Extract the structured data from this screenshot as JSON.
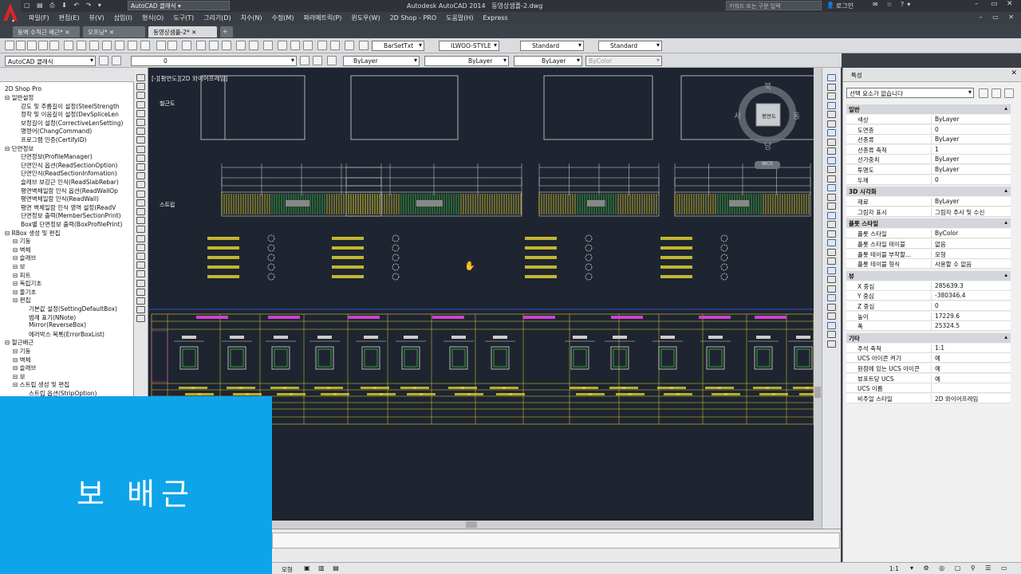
{
  "titlebar": {
    "quick_access": "AutoCAD 클래식",
    "title": "Autodesk AutoCAD 2014",
    "filename": "동영상샘플-2.dwg",
    "search_placeholder": "키워드 또는 구문 입력",
    "login": "로그인"
  },
  "menu": [
    "파일(F)",
    "편집(E)",
    "뷰(V)",
    "삽입(I)",
    "형식(O)",
    "도구(T)",
    "그리기(D)",
    "치수(N)",
    "수정(M)",
    "파라메트릭(P)",
    "윈도우(W)",
    "2D Shop - PRO",
    "도움말(H)",
    "Express"
  ],
  "tabs": [
    "동벽 수직근 배근*",
    "오프닝*",
    "동영상샘플-2*"
  ],
  "toolbar": {
    "text_style": "BarSetTxt",
    "dim_style": "ILWOO-STYLE",
    "table_style": "Standard",
    "multileader_style": "Standard",
    "workspace": "AutoCAD 클래식",
    "layer": "0",
    "color": "ByLayer",
    "linetype": "ByLayer",
    "lineweight": "ByLayer",
    "plotstyle": "ByColor"
  },
  "tree": {
    "title": "2D Shop Pro",
    "items": [
      {
        "level": 0,
        "label": "일반설정"
      },
      {
        "level": 2,
        "label": "강도 및 주름길이 설정(SteelStrength"
      },
      {
        "level": 2,
        "label": "정착 및 이음길이 설정(DevSpliceLen"
      },
      {
        "level": 2,
        "label": "보정길이 설정(CorrectiveLenSetting)"
      },
      {
        "level": 2,
        "label": "명령어(ChangCommand)"
      },
      {
        "level": 2,
        "label": "프로그램 인증(CertifyID)"
      },
      {
        "level": 0,
        "label": "단면정보"
      },
      {
        "level": 2,
        "label": "단면정보(ProfileManager)"
      },
      {
        "level": 2,
        "label": "단면인식 옵션(ReadSectionOption)"
      },
      {
        "level": 2,
        "label": "단면인식(ReadSectionInfomation)"
      },
      {
        "level": 2,
        "label": "슬래브 보강근 인식(ReadSlabRebar)"
      },
      {
        "level": 2,
        "label": "평면벽체일람 인식 옵션(ReadWallOp"
      },
      {
        "level": 2,
        "label": "평면벽체일람 인식(ReadWall)"
      },
      {
        "level": 2,
        "label": "평면 벽체일람 인식 영역 설정(ReadV"
      },
      {
        "level": 2,
        "label": "단면정보 출력(MemberSectionPrint)"
      },
      {
        "level": 2,
        "label": "Box별 단면정보 출력(BoxProfilePrint)"
      },
      {
        "level": 0,
        "label": "RBox 생성 및 편집"
      },
      {
        "level": 1,
        "label": "기둥"
      },
      {
        "level": 1,
        "label": "벽체"
      },
      {
        "level": 1,
        "label": "슬래브"
      },
      {
        "level": 1,
        "label": "보"
      },
      {
        "level": 1,
        "label": "피트"
      },
      {
        "level": 1,
        "label": "독립기초"
      },
      {
        "level": 1,
        "label": "줄기초"
      },
      {
        "level": 1,
        "label": "편집"
      },
      {
        "level": 3,
        "label": "기본값 설정(SettingDefaultBox)"
      },
      {
        "level": 3,
        "label": "범례 표기(NNote)"
      },
      {
        "level": 3,
        "label": "Mirror(ReverseBox)"
      },
      {
        "level": 3,
        "label": "에러박스 목록(ErrorBoxList)"
      },
      {
        "level": 0,
        "label": "철근배근"
      },
      {
        "level": 1,
        "label": "기둥"
      },
      {
        "level": 1,
        "label": "벽체"
      },
      {
        "level": 1,
        "label": "슬래브"
      },
      {
        "level": 1,
        "label": "보"
      },
      {
        "level": 1,
        "label": "스트립 생성 및 편집"
      },
      {
        "level": 3,
        "label": "스트립 옵션(StripOption)"
      }
    ]
  },
  "canvas": {
    "viewport_label": "[-][평면도][2D 와이어프레임]",
    "row_labels": [
      "철근도",
      "스트립"
    ],
    "viewcube": {
      "center": "평면도",
      "north": "북",
      "south": "남",
      "east": "동",
      "west": "서",
      "wcs": "WCS"
    }
  },
  "properties": {
    "title": "특성",
    "selection": "선택 요소가 없습니다",
    "groups": [
      {
        "name": "일반",
        "rows": [
          [
            "색상",
            "ByLayer"
          ],
          [
            "도면층",
            "0"
          ],
          [
            "선종류",
            "ByLayer"
          ],
          [
            "선종류 축척",
            "1"
          ],
          [
            "선가중치",
            "ByLayer"
          ],
          [
            "투명도",
            "ByLayer"
          ],
          [
            "두께",
            "0"
          ]
        ]
      },
      {
        "name": "3D 시각화",
        "rows": [
          [
            "재료",
            "ByLayer"
          ],
          [
            "그림자 표시",
            "그림자 주사 및 수신"
          ]
        ]
      },
      {
        "name": "플롯 스타일",
        "rows": [
          [
            "플롯 스타일",
            "ByColor"
          ],
          [
            "플롯 스타일 테이블",
            "없음"
          ],
          [
            "플롯 테이블 부착할...",
            "모형"
          ],
          [
            "플롯 테이블 형식",
            "사용할 수 없음"
          ]
        ]
      },
      {
        "name": "뷰",
        "rows": [
          [
            "X 중심",
            "285639.3"
          ],
          [
            "Y 중심",
            "-380346.4"
          ],
          [
            "Z 중심",
            "0"
          ],
          [
            "높이",
            "17229.6"
          ],
          [
            "폭",
            "25324.5"
          ]
        ]
      },
      {
        "name": "기타",
        "rows": [
          [
            "주석 축척",
            "1:1"
          ],
          [
            "UCS 아이콘 켜기",
            "예"
          ],
          [
            "원점에 있는 UCS 아이콘",
            "예"
          ],
          [
            "뷰포트당 UCS",
            "예"
          ],
          [
            "UCS 이름",
            ""
          ],
          [
            "비주얼 스타일",
            "2D 와이어프레임"
          ]
        ]
      }
    ]
  },
  "status": {
    "model": "모형",
    "scale": "1:1"
  },
  "overlay": {
    "caption": "보 배근"
  }
}
